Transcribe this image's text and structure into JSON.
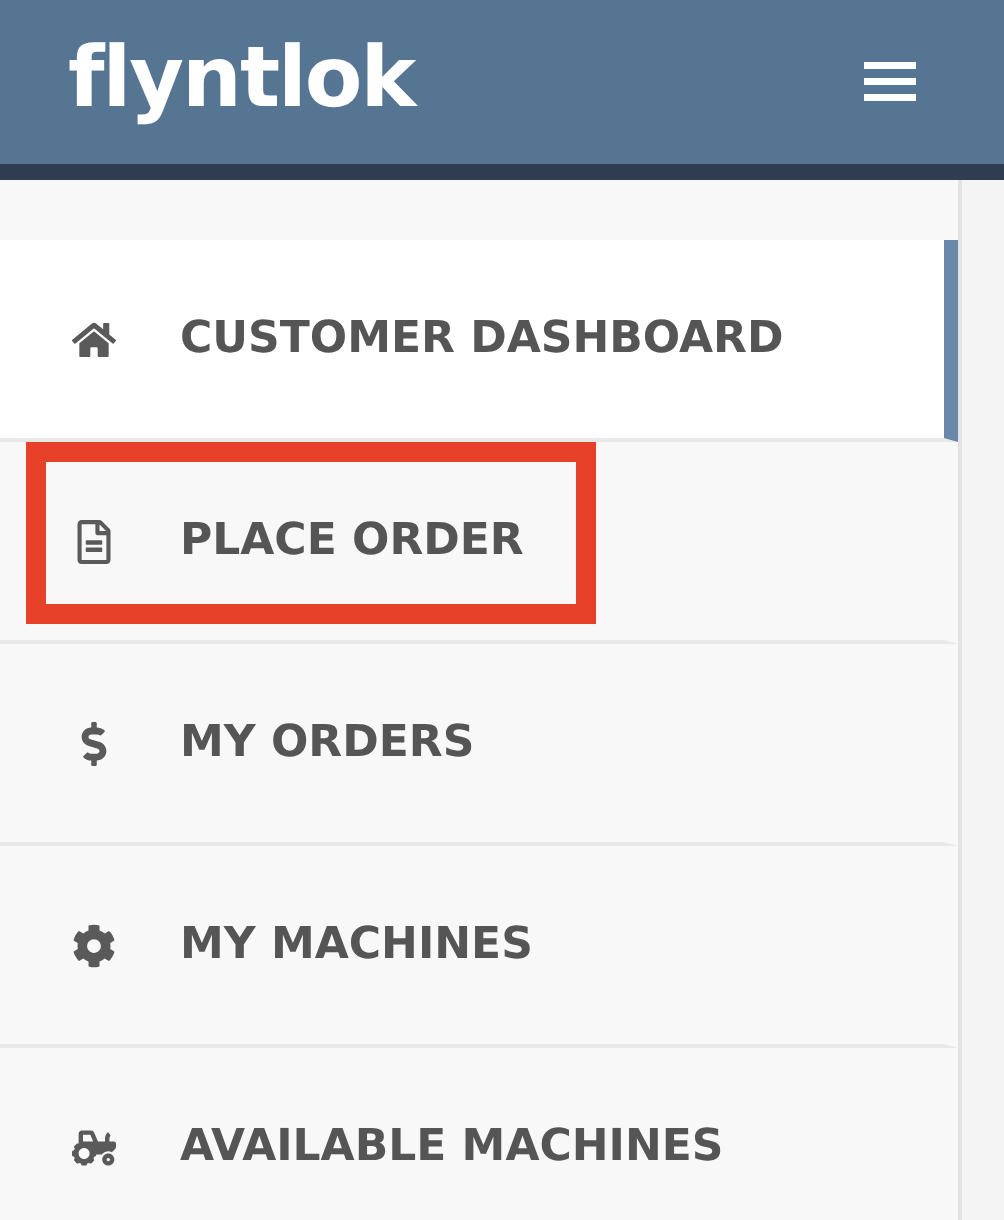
{
  "header": {
    "logo": "flyntlok"
  },
  "sidebar": {
    "items": [
      {
        "label": "CUSTOMER DASHBOARD",
        "selected": true,
        "highlighted": false
      },
      {
        "label": "PLACE ORDER",
        "selected": false,
        "highlighted": true
      },
      {
        "label": "MY ORDERS",
        "selected": false,
        "highlighted": false
      },
      {
        "label": "MY MACHINES",
        "selected": false,
        "highlighted": false
      },
      {
        "label": "AVAILABLE MACHINES",
        "selected": false,
        "highlighted": false
      }
    ]
  }
}
